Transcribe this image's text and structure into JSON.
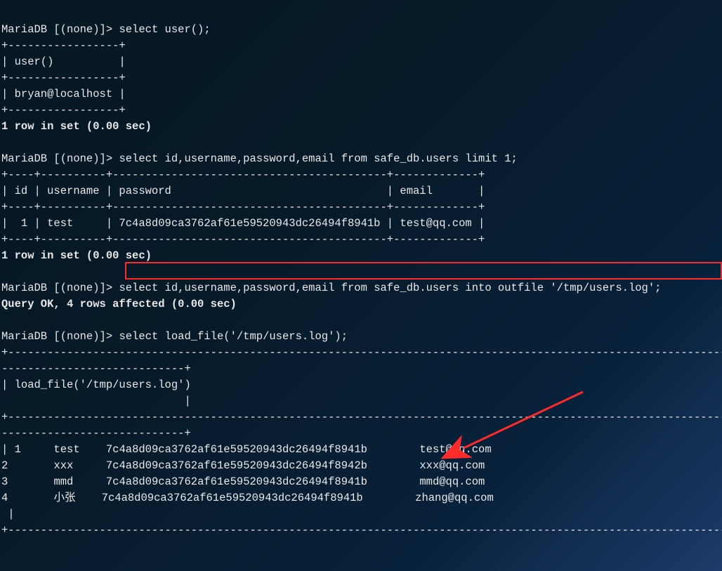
{
  "prompt": "MariaDB [(none)]> ",
  "q1": {
    "cmd": "select user();",
    "sep0": "+-----------------+",
    "hdr": "| user()          |",
    "sep1": "+-----------------+",
    "row": "| bryan@localhost |",
    "sep2": "+-----------------+",
    "status": "1 row in set (0.00 sec)"
  },
  "q2": {
    "cmd": "select id,username,password,email from safe_db.users limit 1;",
    "sep0": "+----+----------+------------------------------------------+-------------+",
    "hdr": "| id | username | password                                 | email       |",
    "sep1": "+----+----------+------------------------------------------+-------------+",
    "row": "|  1 | test     | 7c4a8d09ca3762af61e59520943dc26494f8941b | test@qq.com |",
    "sep2": "+----+----------+------------------------------------------+-------------+",
    "status": "1 row in set (0.00 sec)"
  },
  "q3": {
    "cmd": "select id,username,password,email from safe_db.users into outfile '/tmp/users.log';",
    "status": "Query OK, 4 rows affected (0.00 sec)"
  },
  "q4": {
    "cmd": "select load_file('/tmp/users.log');",
    "long_sep": "+---------------------------------------------------------------------------------------------------------------------------",
    "dash_tail": "----------------------------+",
    "hdr": "| load_file('/tmp/users.log')",
    "pipe_tail": "                            |",
    "rows": [
      {
        "id": "| 1",
        "user": "test",
        "hash": "7c4a8d09ca3762af61e59520943dc26494f8941b",
        "email": "test@qq.com"
      },
      {
        "id": "2",
        "user": "xxx",
        "hash": "7c4a8d09ca3762af61e59520943dc26494f8942b",
        "email": "xxx@qq.com"
      },
      {
        "id": "3",
        "user": "mmd",
        "hash": "7c4a8d09ca3762af61e59520943dc26494f8941b",
        "email": "mmd@qq.com"
      },
      {
        "id": "4",
        "user": "小张",
        "hash": "7c4a8d09ca3762af61e59520943dc26494f8941b",
        "email": "zhang@qq.com"
      }
    ],
    "end_pipe": " |",
    "end_sep": "+---------------------------------------------------------------------------------------------------------------------------"
  }
}
